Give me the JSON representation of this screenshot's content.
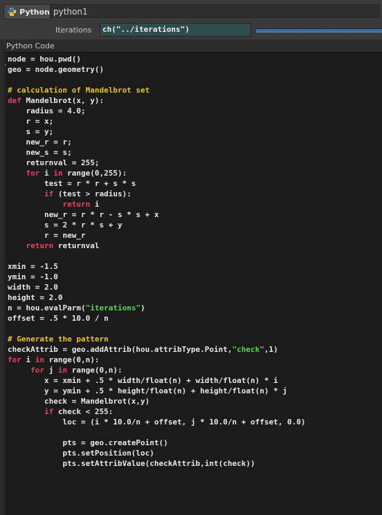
{
  "header": {
    "node_type_label": "Python",
    "node_type_icon": "python-logo-icon",
    "node_name": "python1"
  },
  "parameters": {
    "iterations_label": "Iterations",
    "iterations_expression": "ch(\"../iterations\")",
    "slider_color": "#3d6aa6"
  },
  "code_section": {
    "label": "Python Code"
  },
  "colors": {
    "keyword": "#e6435f",
    "comment": "#e8c13a",
    "string": "#5cd35c",
    "expression_field": "#2f4c4c"
  },
  "code_lines": [
    [
      {
        "t": "node = hou.pwd()"
      }
    ],
    [
      {
        "t": "geo = node.geometry()"
      }
    ],
    [
      {
        "t": ""
      }
    ],
    [
      {
        "t": "# calculation of Mandelbrot set",
        "c": "cm"
      }
    ],
    [
      {
        "t": "def",
        "c": "kw"
      },
      {
        "t": " Mandelbrot(x, y):"
      }
    ],
    [
      {
        "t": "    radius = 4.0;"
      }
    ],
    [
      {
        "t": "    r = x;"
      }
    ],
    [
      {
        "t": "    s = y;"
      }
    ],
    [
      {
        "t": "    new_r = r;"
      }
    ],
    [
      {
        "t": "    new_s = s;"
      }
    ],
    [
      {
        "t": "    returnval = 255;"
      }
    ],
    [
      {
        "t": "    "
      },
      {
        "t": "for",
        "c": "kw"
      },
      {
        "t": " i "
      },
      {
        "t": "in",
        "c": "kw"
      },
      {
        "t": " range(0,255):"
      }
    ],
    [
      {
        "t": "        test = r * r + s * s"
      }
    ],
    [
      {
        "t": "        "
      },
      {
        "t": "if",
        "c": "kw"
      },
      {
        "t": " (test > radius):"
      }
    ],
    [
      {
        "t": "            "
      },
      {
        "t": "return",
        "c": "kw"
      },
      {
        "t": " i"
      }
    ],
    [
      {
        "t": "        new_r = r * r - s * s + x"
      }
    ],
    [
      {
        "t": "        s = 2 * r * s + y"
      }
    ],
    [
      {
        "t": "        r = new_r"
      }
    ],
    [
      {
        "t": "    "
      },
      {
        "t": "return",
        "c": "kw"
      },
      {
        "t": " returnval"
      }
    ],
    [
      {
        "t": ""
      }
    ],
    [
      {
        "t": "xmin = -1.5"
      }
    ],
    [
      {
        "t": "ymin = -1.0"
      }
    ],
    [
      {
        "t": "width = 2.0"
      }
    ],
    [
      {
        "t": "height = 2.0"
      }
    ],
    [
      {
        "t": "n = hou.evalParm("
      },
      {
        "t": "\"iterations\"",
        "c": "st"
      },
      {
        "t": ")"
      }
    ],
    [
      {
        "t": "offset = .5 * 10.0 / n"
      }
    ],
    [
      {
        "t": ""
      }
    ],
    [
      {
        "t": "# Generate the pattern",
        "c": "cm"
      }
    ],
    [
      {
        "t": "checkAttrib = geo.addAttrib(hou.attribType.Point,"
      },
      {
        "t": "\"check\"",
        "c": "st"
      },
      {
        "t": ",1)"
      }
    ],
    [
      {
        "t": "for",
        "c": "kw"
      },
      {
        "t": " i "
      },
      {
        "t": "in",
        "c": "kw"
      },
      {
        "t": " range(0,n):"
      }
    ],
    [
      {
        "t": "     "
      },
      {
        "t": "for",
        "c": "kw"
      },
      {
        "t": " j "
      },
      {
        "t": "in",
        "c": "kw"
      },
      {
        "t": " range(0,n):"
      }
    ],
    [
      {
        "t": "        x = xmin + .5 * width/float(n) + width/float(n) * i"
      }
    ],
    [
      {
        "t": "        y = ymin + .5 * height/float(n) + height/float(n) * j"
      }
    ],
    [
      {
        "t": "        check = Mandelbrot(x,y)"
      }
    ],
    [
      {
        "t": "        "
      },
      {
        "t": "if",
        "c": "kw"
      },
      {
        "t": " check < 255:"
      }
    ],
    [
      {
        "t": "            loc = (i * 10.0/n + offset, j * 10.0/n + offset, 0.0)"
      }
    ],
    [
      {
        "t": ""
      }
    ],
    [
      {
        "t": "            pts = geo.createPoint()"
      }
    ],
    [
      {
        "t": "            pts.setPosition(loc)"
      }
    ],
    [
      {
        "t": "            pts.setAttribValue(checkAttrib,int(check))"
      }
    ]
  ]
}
